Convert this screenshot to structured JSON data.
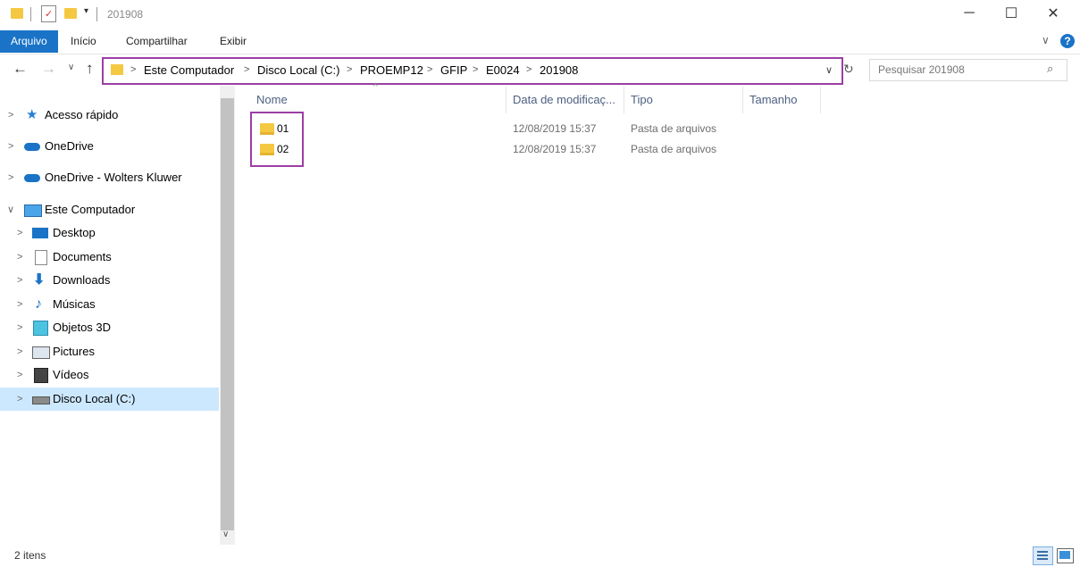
{
  "window": {
    "title": "201908",
    "controls": {
      "minimize": "─",
      "maximize": "☐",
      "close": "✕"
    }
  },
  "ribbon": {
    "tabs": [
      {
        "label": "Arquivo",
        "active": true
      },
      {
        "label": "Início"
      },
      {
        "label": "Compartilhar"
      },
      {
        "label": "Exibir"
      }
    ],
    "expand_icon": "chevron-down",
    "help_label": "?"
  },
  "address": {
    "breadcrumbs": [
      "Este Computador",
      "Disco Local (C:)",
      "PROEMP12",
      "GFIP",
      "E0024",
      "201908"
    ],
    "search_placeholder": "Pesquisar 201908"
  },
  "nav": {
    "items": [
      {
        "label": "Acesso rápido",
        "icon": "star-icon"
      },
      {
        "label": "OneDrive",
        "icon": "cloud-icon"
      },
      {
        "label": "OneDrive - Wolters Kluwer",
        "icon": "cloud-icon"
      },
      {
        "label": "Este Computador",
        "icon": "computer-icon",
        "expanded": true
      },
      {
        "label": "Desktop",
        "icon": "desktop-icon"
      },
      {
        "label": "Documents",
        "icon": "documents-icon"
      },
      {
        "label": "Downloads",
        "icon": "download-icon"
      },
      {
        "label": "Músicas",
        "icon": "music-icon"
      },
      {
        "label": "Objetos 3D",
        "icon": "cube-icon"
      },
      {
        "label": "Pictures",
        "icon": "pictures-icon"
      },
      {
        "label": "Vídeos",
        "icon": "video-icon"
      },
      {
        "label": "Disco Local (C:)",
        "icon": "drive-icon",
        "selected": true
      }
    ]
  },
  "files": {
    "columns": [
      "Nome",
      "Data de modificaç...",
      "Tipo",
      "Tamanho"
    ],
    "rows": [
      {
        "name": "01",
        "date": "12/08/2019 15:37",
        "type": "Pasta de arquivos",
        "size": ""
      },
      {
        "name": "02",
        "date": "12/08/2019 15:37",
        "type": "Pasta de arquivos",
        "size": ""
      }
    ]
  },
  "status": {
    "count": "2 itens"
  },
  "colors": {
    "accent": "#1a73c7",
    "highlight": "#9b3fa4",
    "selection": "#cce8ff",
    "folder": "#f5c842"
  }
}
